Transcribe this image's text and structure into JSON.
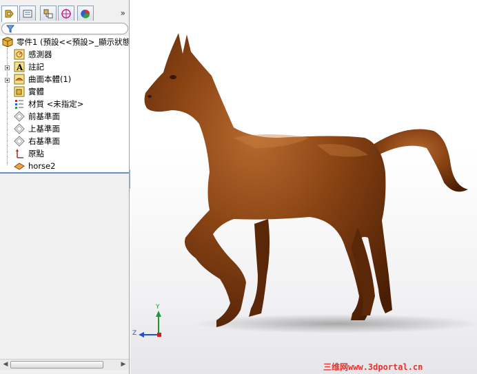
{
  "panel": {
    "tabs": [
      {
        "icon": "feature-manager-icon",
        "active": true
      },
      {
        "icon": "property-manager-icon",
        "active": false
      },
      {
        "icon": "configuration-manager-icon",
        "active": false
      },
      {
        "icon": "dimxpert-icon",
        "active": false
      },
      {
        "icon": "display-manager-icon",
        "active": false
      }
    ],
    "expand_label": "»",
    "tree": {
      "root": "零件1 (預設<<預設>_顯示狀態",
      "items": [
        {
          "label": "感測器",
          "icon": "sensors-icon"
        },
        {
          "label": "註記",
          "icon": "annotations-icon"
        },
        {
          "label": "曲面本體(1)",
          "icon": "surface-bodies-icon"
        },
        {
          "label": "實體",
          "icon": "solid-bodies-icon"
        },
        {
          "label": "材質 <未指定>",
          "icon": "material-icon"
        },
        {
          "label": "前基準面",
          "icon": "front-plane-icon"
        },
        {
          "label": "上基準面",
          "icon": "top-plane-icon"
        },
        {
          "label": "右基準面",
          "icon": "right-plane-icon"
        },
        {
          "label": "原點",
          "icon": "origin-icon"
        },
        {
          "label": "horse2",
          "icon": "imported-surface-icon"
        }
      ]
    }
  },
  "viewport": {
    "model_color": "#7a3a10",
    "triad": {
      "x": "Z",
      "y": "Y"
    }
  },
  "watermark": "三维网www.3dportal.cn",
  "colors": {
    "accent": "#6a8fc0",
    "panel": "#f0f0f0"
  }
}
